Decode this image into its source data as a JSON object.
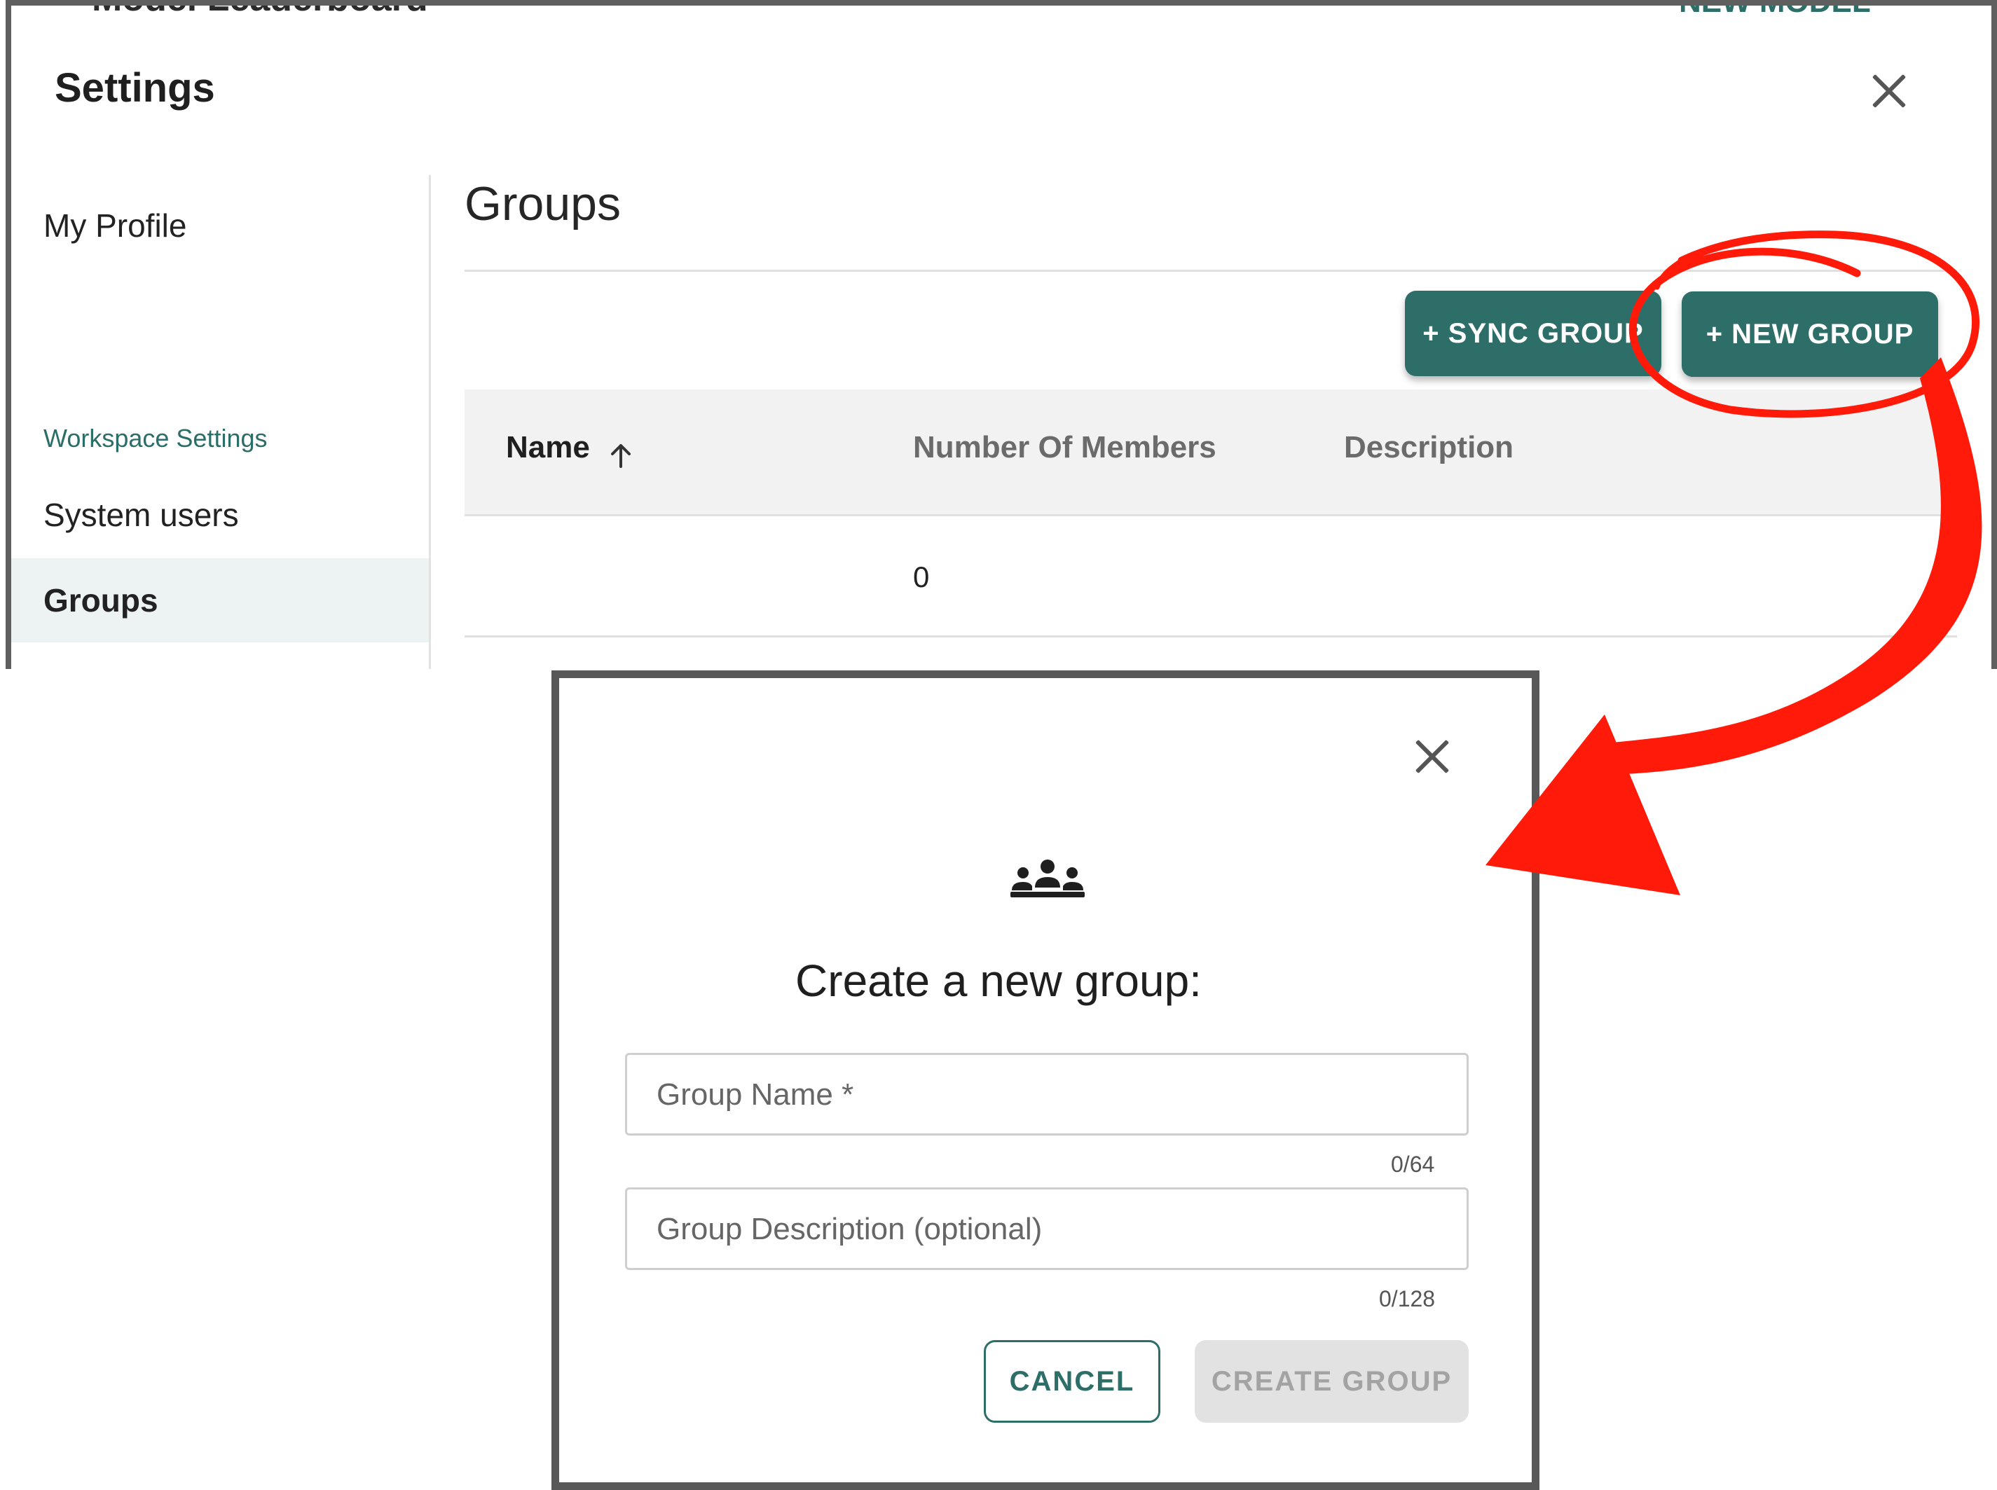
{
  "background_peek": {
    "left_text": "Model Leaderboard",
    "right_text": "NEW MODEL"
  },
  "settings": {
    "title": "Settings",
    "sidebar": {
      "my_profile": "My Profile",
      "workspace_section": "Workspace Settings",
      "system_users": "System users",
      "groups": "Groups"
    },
    "groups_page": {
      "title": "Groups",
      "sync_button": "+ SYNC GROUP",
      "new_button": "+ NEW GROUP",
      "columns": [
        "Name",
        "Number Of Members",
        "Description"
      ],
      "rows": [
        {
          "name": "",
          "members": "0",
          "description": ""
        }
      ]
    }
  },
  "dialog": {
    "title": "Create a new group:",
    "group_name_placeholder": "Group Name *",
    "group_name_counter": "0/64",
    "group_description_placeholder": "Group Description (optional)",
    "group_description_counter": "0/128",
    "cancel_label": "CANCEL",
    "create_label": "CREATE GROUP",
    "icon": "group-people-icon"
  },
  "annotation": {
    "color": "#ff1a0a",
    "highlight": "circle around NEW GROUP button",
    "arrow": "curved arrow pointing to dialog"
  },
  "colors": {
    "accent": "#2d6e68",
    "selected_nav_bg": "#edf2f2",
    "table_header_bg": "#f2f2f2",
    "disabled_bg": "#e2e2e2"
  }
}
